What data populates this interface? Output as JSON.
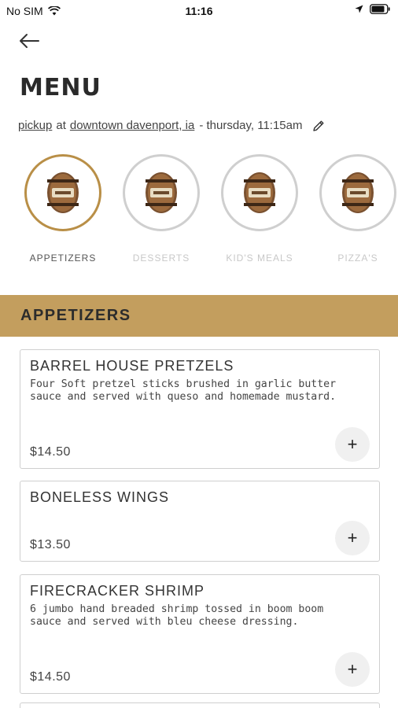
{
  "status_bar": {
    "carrier": "No SIM",
    "time": "11:16"
  },
  "header": {
    "title": "MENU"
  },
  "order_info": {
    "method": "pickup",
    "at": "at",
    "location": "downtown davenport, ia",
    "time": "- thursday, 11:15am"
  },
  "categories": [
    {
      "label": "APPETIZERS",
      "active": true
    },
    {
      "label": "DESSERTS",
      "active": false
    },
    {
      "label": "KID'S MEALS",
      "active": false
    },
    {
      "label": "PIZZA'S",
      "active": false
    }
  ],
  "section": {
    "title": "APPETIZERS"
  },
  "items": [
    {
      "name": "BARREL HOUSE PRETZELS",
      "description": "Four Soft pretzel sticks brushed in garlic butter sauce and served with queso and homemade mustard.",
      "price": "$14.50",
      "add_label": "+"
    },
    {
      "name": "BONELESS WINGS",
      "description": "",
      "price": "$13.50",
      "add_label": "+"
    },
    {
      "name": "FIRECRACKER SHRIMP",
      "description": "6 jumbo hand breaded shrimp tossed in boom boom sauce and served with bleu cheese dressing.",
      "price": "$14.50",
      "add_label": "+"
    }
  ],
  "colors": {
    "accent": "#c39e5e",
    "active_ring": "#b98f47",
    "inactive_ring": "#cfcfcf"
  }
}
